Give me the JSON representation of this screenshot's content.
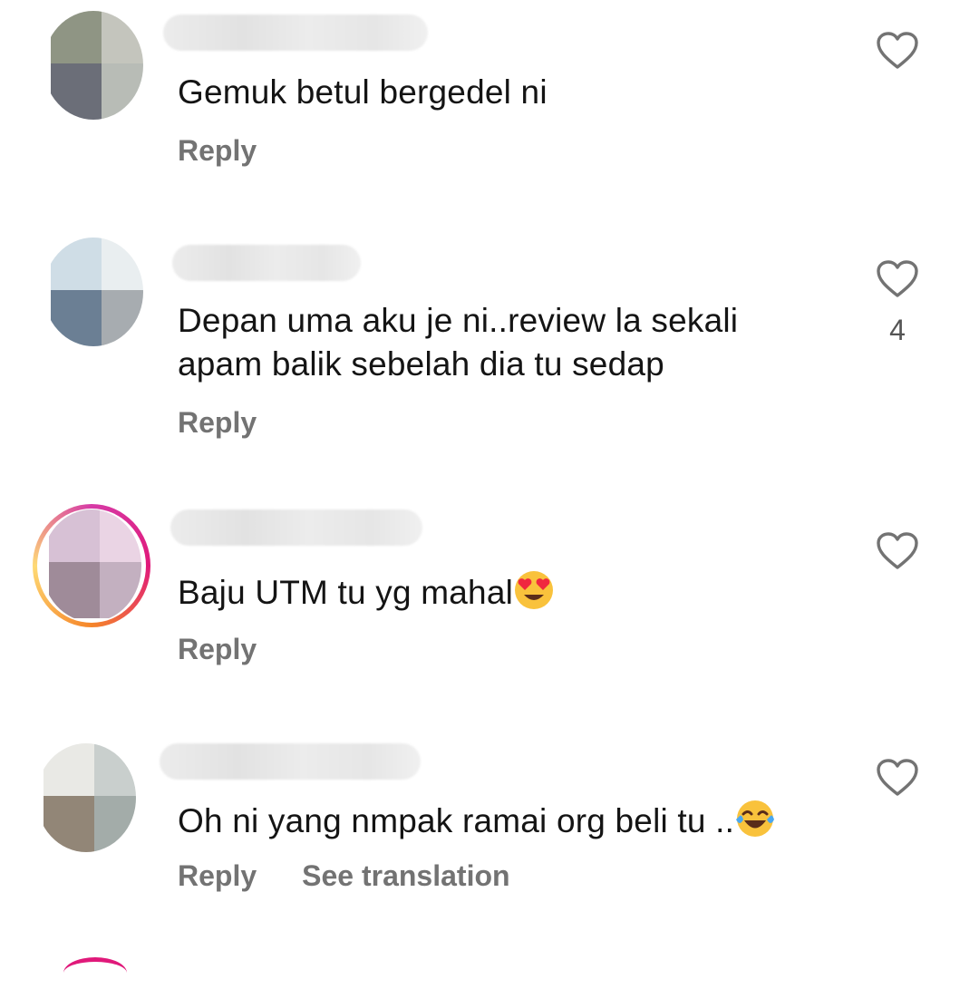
{
  "comments": [
    {
      "text": "Gemuk betul bergedel ni",
      "reply_label": "Reply",
      "likes": "",
      "avatar": {
        "colors": [
          "#8f9584",
          "#c4c5bd",
          "#6b6e78",
          "#b8bcb6"
        ]
      }
    },
    {
      "text_lines": [
        "Depan uma aku je ni..review la sekali",
        "apam balik sebelah dia tu sedap"
      ],
      "reply_label": "Reply",
      "likes": "4",
      "avatar": {
        "colors": [
          "#cfdde6",
          "#e9eef0",
          "#6b7f94",
          "#a7acb0"
        ]
      }
    },
    {
      "text": "Baju UTM tu yg mahal",
      "emoji": "heart-eyes-emoji",
      "reply_label": "Reply",
      "likes": "",
      "avatar": {
        "colors": [
          "#d7c1d5",
          "#ead4e4",
          "#9f8b99",
          "#c3b0c0"
        ]
      }
    },
    {
      "text": "Oh ni yang nmpak ramai org beli tu ..",
      "emoji": "tears-of-joy-emoji",
      "reply_label": "Reply",
      "translate_label": "See translation",
      "likes": "",
      "avatar": {
        "colors": [
          "#e9e9e5",
          "#c9cfcd",
          "#928677",
          "#a3aca9"
        ]
      }
    }
  ],
  "theme": {
    "text": "#141414",
    "secondary": "#737373",
    "background": "#ffffff"
  }
}
